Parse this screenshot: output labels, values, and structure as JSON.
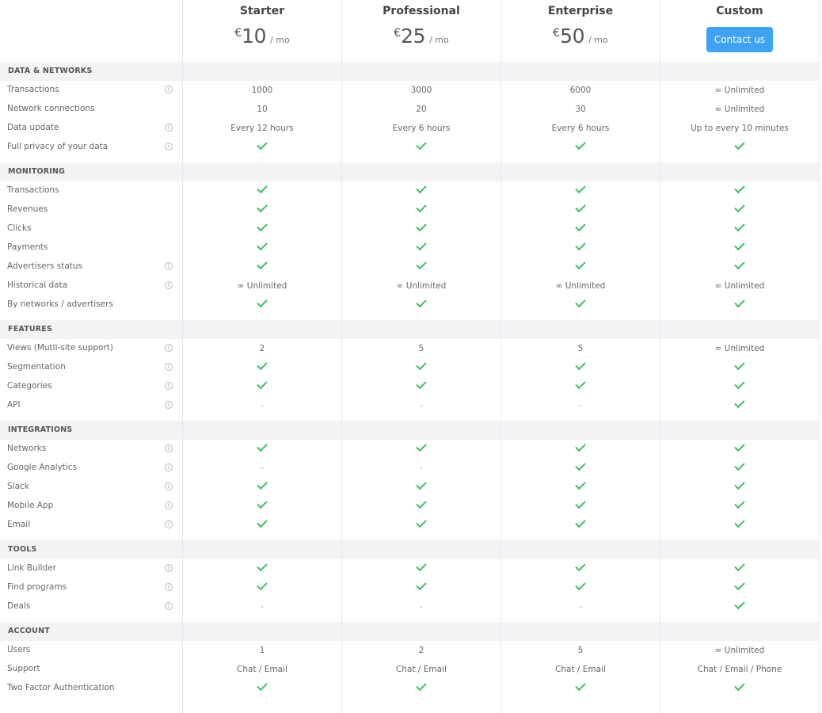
{
  "plans": [
    {
      "name": "Starter",
      "currency": "€",
      "amount": "10",
      "period": "/ mo"
    },
    {
      "name": "Professional",
      "currency": "€",
      "amount": "25",
      "period": "/ mo"
    },
    {
      "name": "Enterprise",
      "currency": "€",
      "amount": "50",
      "period": "/ mo"
    },
    {
      "name": "Custom",
      "cta": "Contact us"
    }
  ],
  "sections": [
    {
      "title": "DATA & NETWORKS",
      "rows": [
        {
          "label": "Transactions",
          "info": true,
          "values": [
            "1000",
            "3000",
            "6000",
            "∞ Unlimited"
          ]
        },
        {
          "label": "Network connections",
          "info": false,
          "values": [
            "10",
            "20",
            "30",
            "∞ Unlimited"
          ]
        },
        {
          "label": "Data update",
          "info": true,
          "values": [
            "Every 12 hours",
            "Every 6 hours",
            "Every 6 hours",
            "Up to every 10 minutes"
          ]
        },
        {
          "label": "Full privacy of your data",
          "info": true,
          "values": [
            "check",
            "check",
            "check",
            "check"
          ]
        }
      ]
    },
    {
      "title": "MONITORING",
      "rows": [
        {
          "label": "Transactions",
          "info": false,
          "values": [
            "check",
            "check",
            "check",
            "check"
          ]
        },
        {
          "label": "Revenues",
          "info": false,
          "values": [
            "check",
            "check",
            "check",
            "check"
          ]
        },
        {
          "label": "Clicks",
          "info": false,
          "values": [
            "check",
            "check",
            "check",
            "check"
          ]
        },
        {
          "label": "Payments",
          "info": false,
          "values": [
            "check",
            "check",
            "check",
            "check"
          ]
        },
        {
          "label": "Advertisers status",
          "info": true,
          "values": [
            "check",
            "check",
            "check",
            "check"
          ]
        },
        {
          "label": "Historical data",
          "info": true,
          "values": [
            "∞ Unlimited",
            "∞ Unlimited",
            "∞ Unlimited",
            "∞ Unlimited"
          ]
        },
        {
          "label": "By networks / advertisers",
          "info": false,
          "values": [
            "check",
            "check",
            "check",
            "check"
          ]
        }
      ]
    },
    {
      "title": "FEATURES",
      "rows": [
        {
          "label": "Views (Mutli-site support)",
          "info": true,
          "values": [
            "2",
            "5",
            "5",
            "∞ Unlimited"
          ]
        },
        {
          "label": "Segmentation",
          "info": true,
          "values": [
            "check",
            "check",
            "check",
            "check"
          ]
        },
        {
          "label": "Categories",
          "info": true,
          "values": [
            "check",
            "check",
            "check",
            "check"
          ]
        },
        {
          "label": "API",
          "info": true,
          "values": [
            "-",
            "-",
            "-",
            "check"
          ]
        }
      ]
    },
    {
      "title": "INTEGRATIONS",
      "rows": [
        {
          "label": "Networks",
          "info": true,
          "values": [
            "check",
            "check",
            "check",
            "check"
          ]
        },
        {
          "label": "Google Analytics",
          "info": true,
          "values": [
            "-",
            "-",
            "check",
            "check"
          ]
        },
        {
          "label": "Slack",
          "info": true,
          "values": [
            "check",
            "check",
            "check",
            "check"
          ]
        },
        {
          "label": "Mobile App",
          "info": true,
          "values": [
            "check",
            "check",
            "check",
            "check"
          ]
        },
        {
          "label": "Email",
          "info": true,
          "values": [
            "check",
            "check",
            "check",
            "check"
          ]
        }
      ]
    },
    {
      "title": "TOOLS",
      "rows": [
        {
          "label": "Link Builder",
          "info": true,
          "values": [
            "check",
            "check",
            "check",
            "check"
          ]
        },
        {
          "label": "Find programs",
          "info": true,
          "values": [
            "check",
            "check",
            "check",
            "check"
          ]
        },
        {
          "label": "Deals",
          "info": true,
          "values": [
            "-",
            "-",
            "-",
            "check"
          ]
        }
      ]
    },
    {
      "title": "ACCOUNT",
      "rows": [
        {
          "label": "Users",
          "info": false,
          "values": [
            "1",
            "2",
            "5",
            "∞ Unlimited"
          ]
        },
        {
          "label": "Support",
          "info": false,
          "values": [
            "Chat / Email",
            "Chat / Email",
            "Chat / Email",
            "Chat / Email / Phone"
          ]
        },
        {
          "label": "Two Factor Authentication",
          "info": false,
          "values": [
            "check",
            "check",
            "check",
            "check"
          ]
        }
      ]
    }
  ],
  "icons": {
    "info": "info-icon",
    "check": "checkmark-icon",
    "dash": "not-included"
  },
  "colors": {
    "accent": "#3ea3f5",
    "check": "#3cbf6a",
    "section_bg": "#f2f3f5",
    "divider": "#e6e8ec"
  }
}
